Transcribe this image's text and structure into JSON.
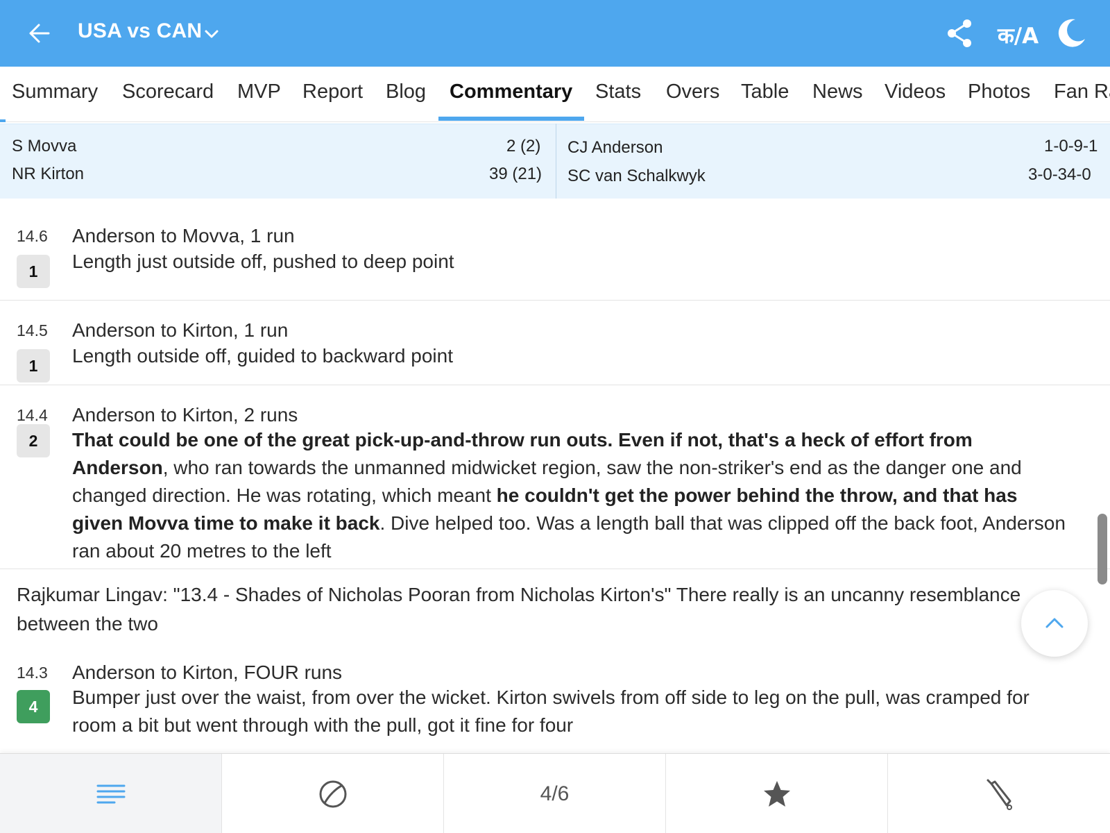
{
  "header": {
    "title": "USA vs CAN",
    "lang_label": "क/A",
    "bg_color": "#4ea7ee"
  },
  "tabs": [
    {
      "label": "Summary"
    },
    {
      "label": "Scorecard"
    },
    {
      "label": "MVP"
    },
    {
      "label": "Report"
    },
    {
      "label": "Blog"
    },
    {
      "label": "Commentary",
      "active": true
    },
    {
      "label": "Stats"
    },
    {
      "label": "Overs"
    },
    {
      "label": "Table"
    },
    {
      "label": "News"
    },
    {
      "label": "Videos"
    },
    {
      "label": "Photos"
    },
    {
      "label": "Fan Ra"
    }
  ],
  "live": {
    "batters": [
      {
        "name": "S Movva",
        "score": "2 (2)"
      },
      {
        "name": "NR Kirton",
        "score": "39 (21)"
      }
    ],
    "bowlers": [
      {
        "name": "CJ Anderson",
        "figures": "1-0-9-1"
      },
      {
        "name": "SC van Schalkwyk",
        "figures": "3-0-34-0"
      }
    ]
  },
  "commentary": [
    {
      "over": "14.6",
      "runs": "1",
      "headline": "Anderson to Movva, 1 run",
      "text": "Length just outside off, pushed to deep point"
    },
    {
      "over": "14.5",
      "runs": "1",
      "headline": "Anderson to Kirton, 1 run",
      "text": "Length outside off, guided to backward point"
    },
    {
      "over": "14.4",
      "runs": "2",
      "headline": "Anderson to Kirton, 2 runs",
      "bold1": "That could be one of the great pick-up-and-throw run outs. Even if not, that's a heck of effort from Anderson",
      "plain1": ", who ran towards the unmanned midwicket region, saw the non-striker's end as the danger one and changed direction. He was rotating, which meant ",
      "bold2": "he couldn't get the power behind the throw, and that has given Movva time to make it back",
      "plain2": ". Dive helped too. Was a length ball that was clipped off the back foot, Anderson ran about 20 metres to the left"
    },
    {
      "over": "14.3",
      "runs": "4",
      "headline": "Anderson to Kirton, FOUR runs",
      "text": "Bumper just over the waist, from over the wicket. Kirton swivels from off side to leg on the pull, was cramped for room a bit but went through with the pull, got it fine for four"
    }
  ],
  "fan_note": "Rajkumar Lingav: \"13.4 - Shades of Nicholas Pooran from Nicholas Kirton's\" There really is an uncanny resemblance between the two",
  "bottom_nav": {
    "pager": "4/6"
  }
}
